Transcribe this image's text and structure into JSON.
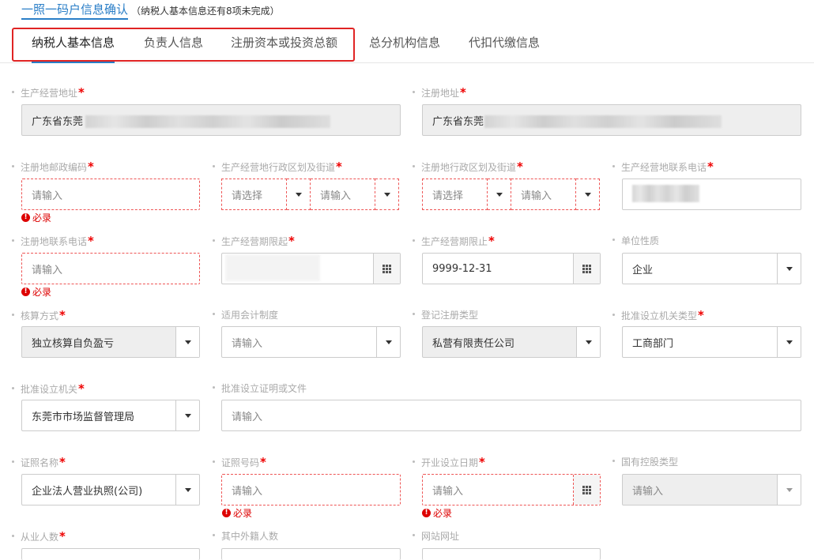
{
  "header": {
    "title": "一照一码户信息确认",
    "subtitle": "（纳税人基本信息还有8项未完成）"
  },
  "tabs": [
    {
      "label": "纳税人基本信息"
    },
    {
      "label": "负责人信息"
    },
    {
      "label": "注册资本或投资总额"
    },
    {
      "label": "总分机构信息"
    },
    {
      "label": "代扣代缴信息"
    }
  ],
  "common": {
    "placeholder_input": "请输入",
    "placeholder_select": "请选择",
    "error_required": "必录",
    "required_mark": "*"
  },
  "fields": {
    "prod_address": {
      "label": "生产经营地址",
      "value": "广东省东莞"
    },
    "reg_address": {
      "label": "注册地址",
      "value": "广东省东莞"
    },
    "reg_postcode": {
      "label": "注册地邮政编码"
    },
    "prod_district": {
      "label": "生产经营地行政区划及街道"
    },
    "reg_district": {
      "label": "注册地行政区划及街道"
    },
    "prod_phone": {
      "label": "生产经营地联系电话"
    },
    "reg_phone": {
      "label": "注册地联系电话"
    },
    "prod_start": {
      "label": "生产经营期限起"
    },
    "prod_end": {
      "label": "生产经营期限止",
      "value": "9999-12-31"
    },
    "unit_nature": {
      "label": "单位性质",
      "value": "企业"
    },
    "accounting_method": {
      "label": "核算方式",
      "value": "独立核算自负盈亏"
    },
    "accounting_system": {
      "label": "适用会计制度"
    },
    "reg_type": {
      "label": "登记注册类型",
      "value": "私营有限责任公司"
    },
    "approval_org_type": {
      "label": "批准设立机关类型",
      "value": "工商部门"
    },
    "approval_org": {
      "label": "批准设立机关",
      "value": "东莞市市场监督管理局"
    },
    "approval_doc": {
      "label": "批准设立证明或文件"
    },
    "cert_name": {
      "label": "证照名称",
      "value": "企业法人营业执照(公司)"
    },
    "cert_no": {
      "label": "证照号码"
    },
    "open_date": {
      "label": "开业设立日期"
    },
    "state_holding": {
      "label": "国有控股类型"
    },
    "employees": {
      "label": "从业人数"
    },
    "foreign_employees": {
      "label": "其中外籍人数"
    },
    "website": {
      "label": "网站网址"
    }
  }
}
